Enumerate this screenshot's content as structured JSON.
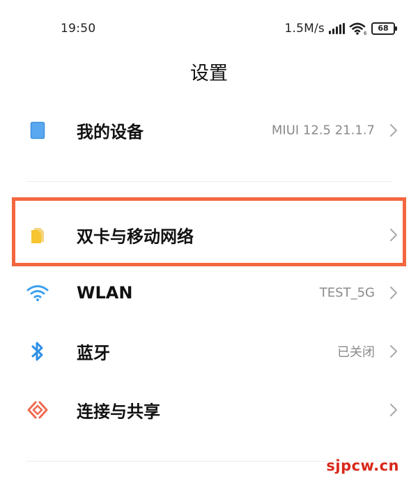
{
  "status_bar": {
    "time": "19:50",
    "net_speed": "1.5M/s",
    "battery": "68"
  },
  "title": "设置",
  "items": [
    {
      "label": "我的设备",
      "value": "MIUI 12.5 21.1.7",
      "icon": "device-icon"
    },
    {
      "label": "双卡与移动网络",
      "value": "",
      "icon": "sim-card-icon"
    },
    {
      "label": "WLAN",
      "value": "TEST_5G",
      "icon": "wifi-icon"
    },
    {
      "label": "蓝牙",
      "value": "已关闭",
      "icon": "bluetooth-icon"
    },
    {
      "label": "连接与共享",
      "value": "",
      "icon": "connection-share-icon"
    }
  ],
  "colors": {
    "highlight": "#f4663f",
    "device_icon": "#5aa9f0",
    "sim_icon": "#f7c531",
    "wifi_icon": "#3da0ee",
    "bluetooth_icon": "#2f8fe6",
    "share_icon": "#ef6a50",
    "watermark": "#d8281a"
  },
  "watermark": "sjpcw.cn"
}
